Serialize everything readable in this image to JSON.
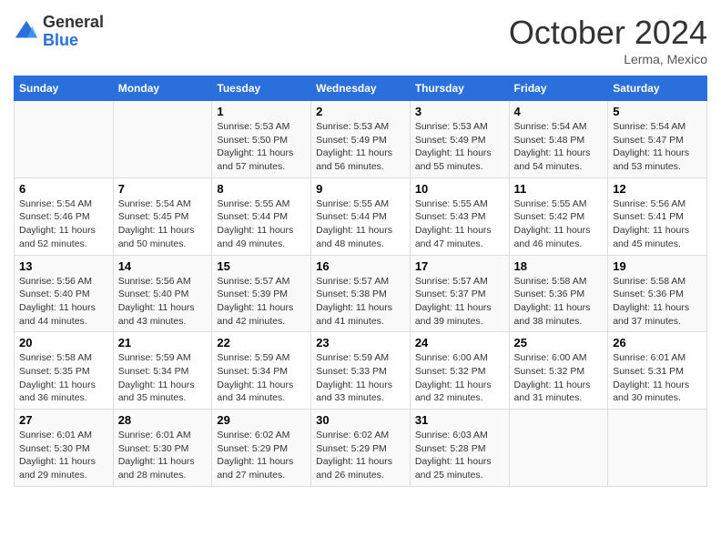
{
  "header": {
    "logo": {
      "general": "General",
      "blue": "Blue"
    },
    "month": "October 2024",
    "location": "Lerma, Mexico"
  },
  "weekdays": [
    "Sunday",
    "Monday",
    "Tuesday",
    "Wednesday",
    "Thursday",
    "Friday",
    "Saturday"
  ],
  "weeks": [
    [
      {
        "day": "",
        "info": ""
      },
      {
        "day": "",
        "info": ""
      },
      {
        "day": "1",
        "info": "Sunrise: 5:53 AM\nSunset: 5:50 PM\nDaylight: 11 hours and 57 minutes."
      },
      {
        "day": "2",
        "info": "Sunrise: 5:53 AM\nSunset: 5:49 PM\nDaylight: 11 hours and 56 minutes."
      },
      {
        "day": "3",
        "info": "Sunrise: 5:53 AM\nSunset: 5:49 PM\nDaylight: 11 hours and 55 minutes."
      },
      {
        "day": "4",
        "info": "Sunrise: 5:54 AM\nSunset: 5:48 PM\nDaylight: 11 hours and 54 minutes."
      },
      {
        "day": "5",
        "info": "Sunrise: 5:54 AM\nSunset: 5:47 PM\nDaylight: 11 hours and 53 minutes."
      }
    ],
    [
      {
        "day": "6",
        "info": "Sunrise: 5:54 AM\nSunset: 5:46 PM\nDaylight: 11 hours and 52 minutes."
      },
      {
        "day": "7",
        "info": "Sunrise: 5:54 AM\nSunset: 5:45 PM\nDaylight: 11 hours and 50 minutes."
      },
      {
        "day": "8",
        "info": "Sunrise: 5:55 AM\nSunset: 5:44 PM\nDaylight: 11 hours and 49 minutes."
      },
      {
        "day": "9",
        "info": "Sunrise: 5:55 AM\nSunset: 5:44 PM\nDaylight: 11 hours and 48 minutes."
      },
      {
        "day": "10",
        "info": "Sunrise: 5:55 AM\nSunset: 5:43 PM\nDaylight: 11 hours and 47 minutes."
      },
      {
        "day": "11",
        "info": "Sunrise: 5:55 AM\nSunset: 5:42 PM\nDaylight: 11 hours and 46 minutes."
      },
      {
        "day": "12",
        "info": "Sunrise: 5:56 AM\nSunset: 5:41 PM\nDaylight: 11 hours and 45 minutes."
      }
    ],
    [
      {
        "day": "13",
        "info": "Sunrise: 5:56 AM\nSunset: 5:40 PM\nDaylight: 11 hours and 44 minutes."
      },
      {
        "day": "14",
        "info": "Sunrise: 5:56 AM\nSunset: 5:40 PM\nDaylight: 11 hours and 43 minutes."
      },
      {
        "day": "15",
        "info": "Sunrise: 5:57 AM\nSunset: 5:39 PM\nDaylight: 11 hours and 42 minutes."
      },
      {
        "day": "16",
        "info": "Sunrise: 5:57 AM\nSunset: 5:38 PM\nDaylight: 11 hours and 41 minutes."
      },
      {
        "day": "17",
        "info": "Sunrise: 5:57 AM\nSunset: 5:37 PM\nDaylight: 11 hours and 39 minutes."
      },
      {
        "day": "18",
        "info": "Sunrise: 5:58 AM\nSunset: 5:36 PM\nDaylight: 11 hours and 38 minutes."
      },
      {
        "day": "19",
        "info": "Sunrise: 5:58 AM\nSunset: 5:36 PM\nDaylight: 11 hours and 37 minutes."
      }
    ],
    [
      {
        "day": "20",
        "info": "Sunrise: 5:58 AM\nSunset: 5:35 PM\nDaylight: 11 hours and 36 minutes."
      },
      {
        "day": "21",
        "info": "Sunrise: 5:59 AM\nSunset: 5:34 PM\nDaylight: 11 hours and 35 minutes."
      },
      {
        "day": "22",
        "info": "Sunrise: 5:59 AM\nSunset: 5:34 PM\nDaylight: 11 hours and 34 minutes."
      },
      {
        "day": "23",
        "info": "Sunrise: 5:59 AM\nSunset: 5:33 PM\nDaylight: 11 hours and 33 minutes."
      },
      {
        "day": "24",
        "info": "Sunrise: 6:00 AM\nSunset: 5:32 PM\nDaylight: 11 hours and 32 minutes."
      },
      {
        "day": "25",
        "info": "Sunrise: 6:00 AM\nSunset: 5:32 PM\nDaylight: 11 hours and 31 minutes."
      },
      {
        "day": "26",
        "info": "Sunrise: 6:01 AM\nSunset: 5:31 PM\nDaylight: 11 hours and 30 minutes."
      }
    ],
    [
      {
        "day": "27",
        "info": "Sunrise: 6:01 AM\nSunset: 5:30 PM\nDaylight: 11 hours and 29 minutes."
      },
      {
        "day": "28",
        "info": "Sunrise: 6:01 AM\nSunset: 5:30 PM\nDaylight: 11 hours and 28 minutes."
      },
      {
        "day": "29",
        "info": "Sunrise: 6:02 AM\nSunset: 5:29 PM\nDaylight: 11 hours and 27 minutes."
      },
      {
        "day": "30",
        "info": "Sunrise: 6:02 AM\nSunset: 5:29 PM\nDaylight: 11 hours and 26 minutes."
      },
      {
        "day": "31",
        "info": "Sunrise: 6:03 AM\nSunset: 5:28 PM\nDaylight: 11 hours and 25 minutes."
      },
      {
        "day": "",
        "info": ""
      },
      {
        "day": "",
        "info": ""
      }
    ]
  ]
}
